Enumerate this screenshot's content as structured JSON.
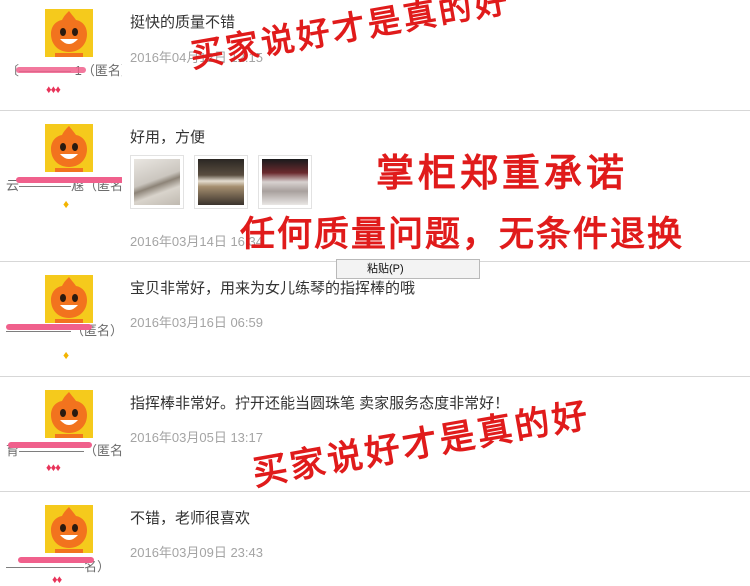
{
  "reviews": [
    {
      "user": "〔———— 1（匿名）",
      "rank": "♦♦♦",
      "text": "挺快的质量不错",
      "date": "2016年04月12日 12:15"
    },
    {
      "user": "云————尮（匿名）",
      "rank": "♦",
      "text": "好用，方便",
      "date": "2016年03月14日 16:34"
    },
    {
      "user": "—————（匿名）",
      "rank": "♦",
      "text": "宝贝非常好，用来为女儿练琴的指挥棒的哦",
      "date": "2016年03月16日 06:59"
    },
    {
      "user": "育—————（匿名）",
      "rank": "♦♦♦",
      "text": "指挥棒非常好。拧开还能当圆珠笔 卖家服务态度非常好！",
      "date": "2016年03月05日 13:17"
    },
    {
      "user": "——————名）",
      "rank": "♦♦",
      "text": "不错，老师很喜欢",
      "date": "2016年03月09日 23:43"
    }
  ],
  "watermarks": {
    "top": "买家说好才是真的好",
    "middle_title": "掌柜郑重承诺",
    "middle_sub": "任何质量问题，无条件退换",
    "bottom": "买家说好才是真的好"
  },
  "context_menu": {
    "paste": "粘贴(P)"
  },
  "colors": {
    "avatar_bg": "#f5ca1c",
    "mascot": "#f2731e",
    "watermark": "#e01b1b",
    "scribble": "#f0608c"
  }
}
